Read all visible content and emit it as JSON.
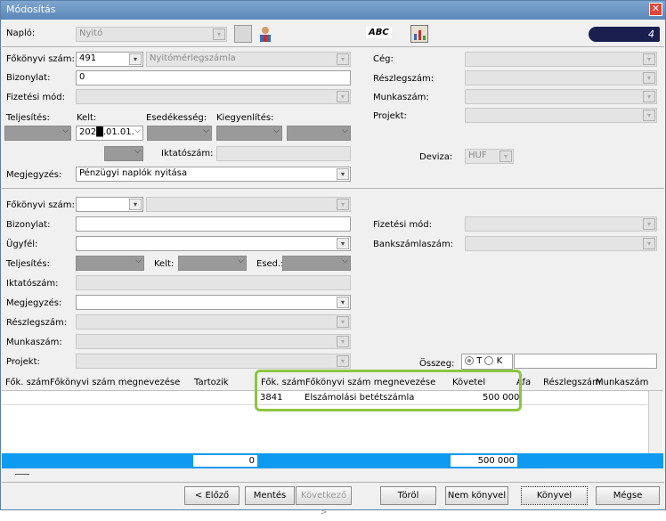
{
  "window": {
    "title": "Módosítás",
    "close_glyph": "✕"
  },
  "top": {
    "naplo_label": "Napló:",
    "naplo_value": "Nyitó",
    "abc_label": "ABC",
    "counter": "4"
  },
  "header": {
    "fokonyvi_label": "Főkönyvi szám:",
    "fokonyvi_value": "491",
    "fokonyvi_name": "Nyitómérlegszámla",
    "bizonylat_label": "Bizonylat:",
    "bizonylat_value": "0",
    "fizetesi_label": "Fizetési mód:",
    "teljesites_label": "Teljesítés:",
    "kelt_label": "Kelt:",
    "kelt_value": "202█.01.01.",
    "esedekesseg_label": "Esedékesség:",
    "kiegyenlites_label": "Kiegyenlítés:",
    "iktatoszam_label": "Iktatószám:",
    "megjegyzes_label": "Megjegyzés:",
    "megjegyzes_value": "Pénzügyi naplók nyitása",
    "ceg_label": "Cég:",
    "reszleg_label": "Részlegszám:",
    "munka_label": "Munkaszám:",
    "projekt_label": "Projekt:",
    "deviza_label": "Deviza:",
    "deviza_value": "HUF"
  },
  "detail": {
    "fokonyvi_label": "Főkönyvi szám:",
    "bizonylat_label": "Bizonylat:",
    "ugyfel_label": "Ügyfél:",
    "teljesites_label": "Teljesítés:",
    "kelt_label": "Kelt:",
    "esed_label": "Esed.:",
    "iktatoszam_label": "Iktatószám:",
    "megjegyzes_label": "Megjegyzés:",
    "reszleg_label": "Részlegszám:",
    "munka_label": "Munkaszám:",
    "projekt_label": "Projekt:",
    "fizetesi_label": "Fizetési mód:",
    "bank_label": "Bankszámlaszám:",
    "osszeg_label": "Összeg:",
    "radio_t": "T",
    "radio_k": "K"
  },
  "grid": {
    "left_headers": [
      "Fők. szám",
      "Főkönyvi szám megnevezése",
      "Tartozik"
    ],
    "right_headers": [
      "Fők. szám",
      "Főkönyvi szám megnevezése",
      "Követel",
      "Áfa",
      "Részlegszám",
      "Munkaszám"
    ],
    "row": {
      "fok": "3841",
      "name": "Elszámolási betétszámla",
      "kovetel": "500 000"
    },
    "total_tartozik": "0",
    "total_kovetel": "500 000"
  },
  "buttons": {
    "prev": "< Előző",
    "save": "Mentés",
    "next": "Következő >",
    "delete": "Töröl",
    "not_book": "Nem könyvel",
    "book": "Könyvel",
    "cancel": "Mégse"
  }
}
